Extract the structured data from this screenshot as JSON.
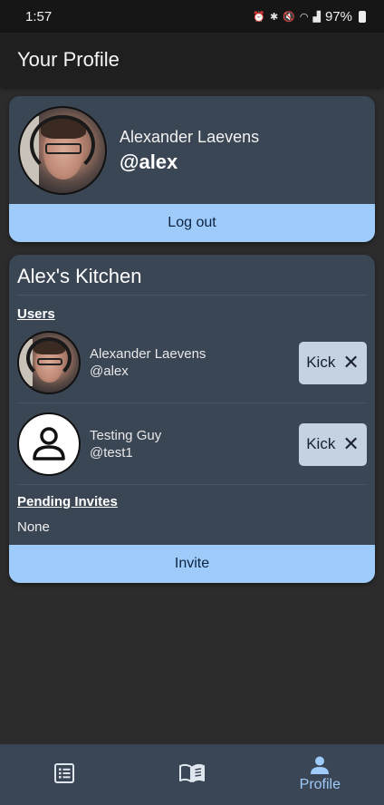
{
  "status": {
    "time": "1:57",
    "battery": "97%"
  },
  "app_bar": {
    "title": "Your Profile"
  },
  "profile": {
    "full_name": "Alexander Laevens",
    "handle": "@alex",
    "logout_label": "Log out"
  },
  "kitchen": {
    "title": "Alex's Kitchen",
    "users_label": "Users",
    "users": [
      {
        "name": "Alexander Laevens",
        "handle": "@alex",
        "kick_label": "Kick"
      },
      {
        "name": "Testing Guy",
        "handle": "@test1",
        "kick_label": "Kick"
      }
    ],
    "pending_label": "Pending Invites",
    "pending_value": "None",
    "invite_label": "Invite"
  },
  "nav": {
    "items": [
      {
        "icon": "list-icon",
        "label": ""
      },
      {
        "icon": "book-icon",
        "label": ""
      },
      {
        "icon": "person-icon",
        "label": "Profile",
        "active": true
      }
    ]
  },
  "colors": {
    "accent": "#9fcbfb",
    "card": "#3b4655",
    "background": "#2c2c2c",
    "kick_button": "#c4d2e1"
  }
}
